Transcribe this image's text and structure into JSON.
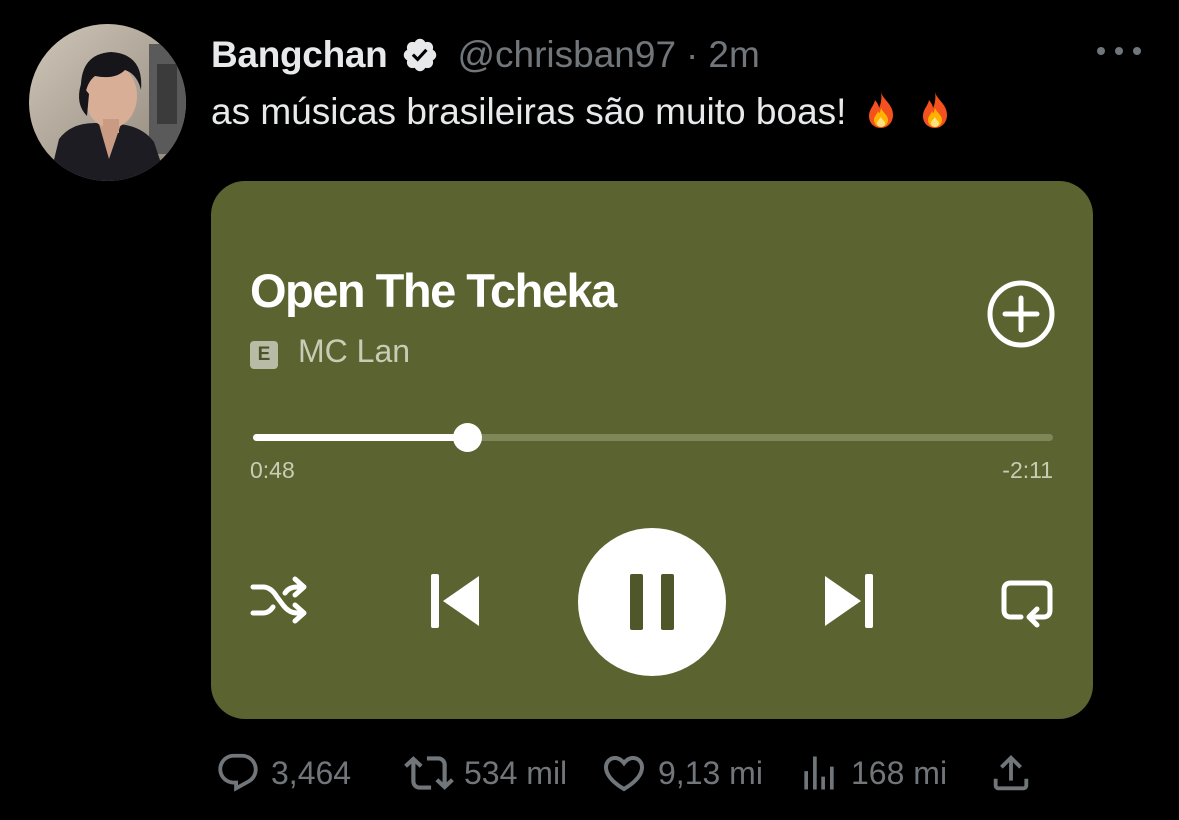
{
  "author": {
    "display_name": "Bangchan",
    "handle": "@chrisban97",
    "separator": "·",
    "timestamp": "2m",
    "verified_icon": "verified-badge-icon"
  },
  "tweet": {
    "text": "as músicas brasileiras são muito boas!",
    "emojis": [
      "fire-icon",
      "fire-icon"
    ]
  },
  "player": {
    "song_title": "Open The Tcheka",
    "explicit_badge": "E",
    "artist": "MC Lan",
    "elapsed": "0:48",
    "remaining": "-2:11",
    "progress_fraction": 0.268,
    "background_color": "#5b6330",
    "controls": [
      "shuffle-icon",
      "skip-previous-icon",
      "pause-icon",
      "skip-next-icon",
      "repeat-icon",
      "add-circle-icon"
    ]
  },
  "actions": {
    "replies": "3,464",
    "retweets": "534 mil",
    "likes": "9,13 mi",
    "views": "168 mi",
    "icons": [
      "reply-icon",
      "retweet-icon",
      "like-icon",
      "views-icon",
      "share-icon"
    ]
  },
  "colors": {
    "background": "#000000",
    "text_primary": "#e7e9ea",
    "text_secondary": "#71767b"
  }
}
